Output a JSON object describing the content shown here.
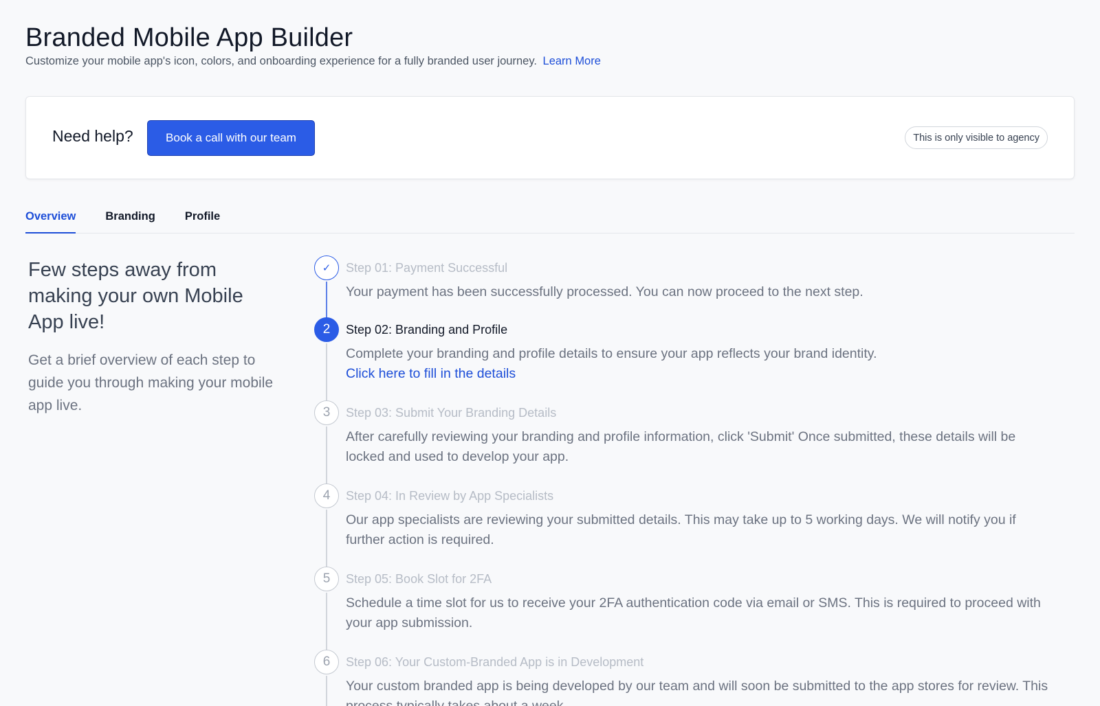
{
  "header": {
    "title": "Branded Mobile App Builder",
    "subtitle": "Customize your mobile app's icon, colors, and onboarding experience for a fully branded user journey.",
    "learn_more": "Learn More"
  },
  "help": {
    "title": "Need help?",
    "button_label": "Book a call with our team",
    "agency_note": "This is only visible to agency"
  },
  "tabs": [
    {
      "label": "Overview",
      "active": true
    },
    {
      "label": "Branding",
      "active": false
    },
    {
      "label": "Profile",
      "active": false
    }
  ],
  "intro": {
    "heading": "Few steps away from making your own Mobile App live!",
    "text": "Get a brief overview of each step to guide you through making your mobile app live."
  },
  "steps": [
    {
      "marker": "✓",
      "state": "done",
      "title": "Step 01: Payment Successful",
      "description": "Your payment has been successfully processed. You can now proceed to the next step."
    },
    {
      "marker": "2",
      "state": "current",
      "title": "Step 02: Branding and Profile",
      "description": "Complete your branding and profile details to ensure your app reflects your brand identity.",
      "link": "Click here to fill in the details"
    },
    {
      "marker": "3",
      "state": "pending",
      "title": "Step 03: Submit Your Branding Details",
      "description": "After carefully reviewing your branding and profile information, click 'Submit' Once submitted, these details will be locked and used to develop your app."
    },
    {
      "marker": "4",
      "state": "pending",
      "title": "Step 04: In Review by App Specialists",
      "description": "Our app specialists are reviewing your submitted details. This may take up to 5 working days. We will notify you if further action is required."
    },
    {
      "marker": "5",
      "state": "pending",
      "title": "Step 05: Book Slot for 2FA",
      "description": "Schedule a time slot for us to receive your 2FA authentication code via email or SMS. This is required to proceed with your app submission."
    },
    {
      "marker": "6",
      "state": "pending",
      "title": "Step 06: Your Custom-Branded App is in Development",
      "description": "Your custom branded app is being developed by our team and will soon be submitted to the app stores for review. This process typically takes about a week."
    }
  ]
}
